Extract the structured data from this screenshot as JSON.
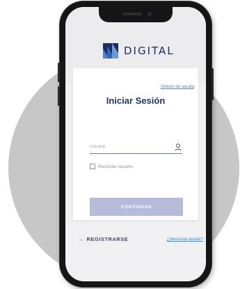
{
  "brand": {
    "name": "DIGITAL",
    "accent_color": "#1f2b5e",
    "logo_icon": "digital-logo-icon"
  },
  "login": {
    "help_videos_link": "Videos de ayuda",
    "title": "Iniciar Sesión",
    "username_placeholder": "Usuario",
    "username_icon": "user-icon",
    "remember_label": "Recordar usuario",
    "remember_checked": false,
    "continue_label": "CONTINUAR",
    "continue_button_color": "#b5bbd9"
  },
  "footer": {
    "register_label": "← REGISTRARSE",
    "help_link": "¿Necesita ayuda?"
  },
  "colors": {
    "link": "#4a86c5",
    "title": "#253562",
    "background_circle": "#c7c7c7"
  }
}
